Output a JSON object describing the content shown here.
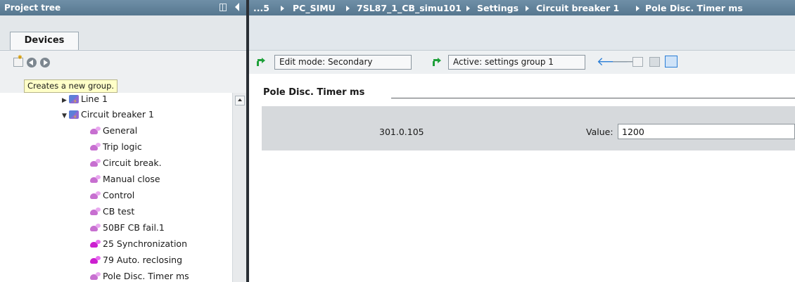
{
  "left_pane": {
    "title": "Project tree",
    "tab_label": "Devices",
    "tooltip": "Creates a new group.",
    "toolbar_icons": [
      "new-group-icon",
      "back-icon",
      "forward-icon"
    ]
  },
  "tree": {
    "items": [
      {
        "label": "Line 1",
        "icon": "device-icon",
        "expanded": false
      },
      {
        "label": "Circuit breaker 1",
        "icon": "device-icon",
        "expanded": true
      },
      {
        "label": "General",
        "icon": "function-block-icon"
      },
      {
        "label": "Trip logic",
        "icon": "function-block-icon"
      },
      {
        "label": "Circuit break.",
        "icon": "function-block-icon"
      },
      {
        "label": "Manual close",
        "icon": "function-block-icon"
      },
      {
        "label": "Control",
        "icon": "function-block-icon"
      },
      {
        "label": "CB test",
        "icon": "function-block-icon"
      },
      {
        "label": "50BF CB fail.1",
        "icon": "function-block-icon"
      },
      {
        "label": "25 Synchronization",
        "icon": "function-block-icon"
      },
      {
        "label": "79 Auto. reclosing",
        "icon": "function-block-icon"
      },
      {
        "label": "Pole Disc. Timer ms",
        "icon": "function-block-icon"
      }
    ]
  },
  "breadcrumb": {
    "segments": [
      "...5",
      "PC_SIMU",
      "7SL87_1_CB_simu101",
      "Settings",
      "Circuit breaker 1",
      "Pole Disc. Timer ms"
    ]
  },
  "editor_toolbar": {
    "edit_mode": "Edit mode: Secondary",
    "active_group": "Active: settings group 1"
  },
  "parameter": {
    "section_title": "Pole Disc. Timer ms",
    "address": "301.0.105",
    "value_label": "Value:",
    "value": "1200"
  },
  "colors": {
    "title_bar": "#56778f",
    "nav_arrow": "#2a7ed6",
    "green_arrow": "#1fa03a",
    "function_icon": "#c76fd0"
  }
}
